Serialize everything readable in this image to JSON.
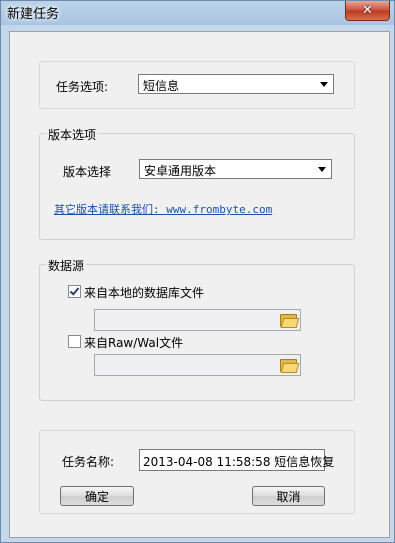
{
  "window": {
    "title": "新建任务",
    "close_symbol": "✕"
  },
  "task_option": {
    "label": "任务选项:",
    "selected": "短信息"
  },
  "version_group": {
    "title": "版本选项",
    "select_label": "版本选择",
    "selected": "安卓通用版本",
    "link_text": "其它版本请联系我们: www.frombyte.com"
  },
  "datasource_group": {
    "title": "数据源",
    "local_db": {
      "label": "来自本地的数据库文件",
      "checked": true,
      "path": ""
    },
    "raw_wal": {
      "label": "来自Raw/Wal文件",
      "checked": false,
      "path": ""
    }
  },
  "task_name": {
    "label": "任务名称:",
    "value": "2013-04-08 11:58:58 短信息恢复"
  },
  "buttons": {
    "ok": "确定",
    "cancel": "取消"
  }
}
